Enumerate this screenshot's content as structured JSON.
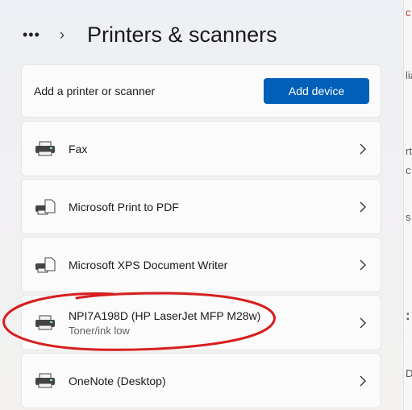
{
  "header": {
    "more_label": "•••",
    "separator": "›",
    "title": "Printers & scanners"
  },
  "add_section": {
    "label": "Add a printer or scanner",
    "button_label": "Add device"
  },
  "devices": [
    {
      "name": "Fax",
      "status": "",
      "icon": "fax-printer-icon"
    },
    {
      "name": "Microsoft Print to PDF",
      "status": "",
      "icon": "virtual-printer-icon"
    },
    {
      "name": "Microsoft XPS Document Writer",
      "status": "",
      "icon": "virtual-printer-icon"
    },
    {
      "name": "NPI7A198D (HP LaserJet MFP M28w)",
      "status": "Toner/ink low",
      "icon": "printer-icon"
    },
    {
      "name": "OneNote (Desktop)",
      "status": "",
      "icon": "printer-icon"
    }
  ],
  "colors": {
    "accent": "#005fb8",
    "annotation": "#d81e1e"
  }
}
